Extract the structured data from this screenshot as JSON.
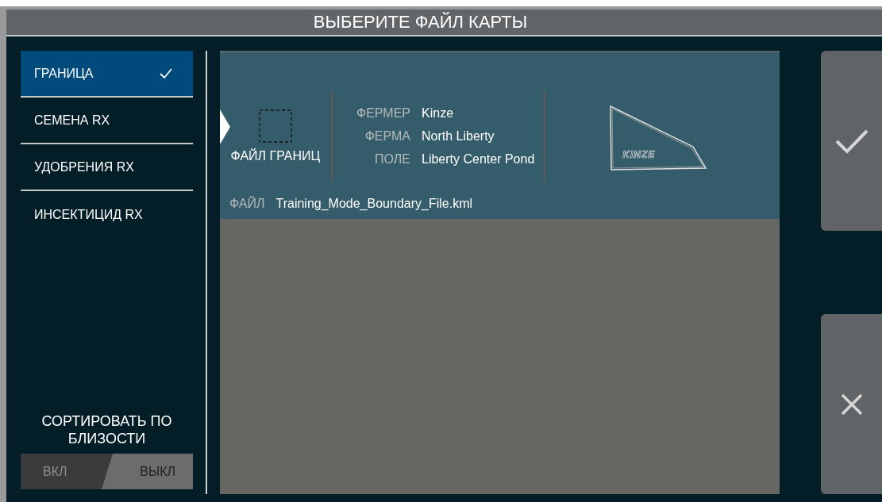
{
  "window": {
    "title": "ВЫБЕРИТЕ ФАЙЛ КАРТЫ"
  },
  "categories": [
    {
      "label": "ГРАНИЦА",
      "selected": true
    },
    {
      "label": "СЕМЕНА RX",
      "selected": false
    },
    {
      "label": "УДОБРЕНИЯ RX",
      "selected": false
    },
    {
      "label": "ИНСЕКТИЦИД RX",
      "selected": false
    }
  ],
  "sort": {
    "label": "СОРТИРОВАТЬ ПО БЛИЗОСТИ",
    "on": false,
    "on_label": "ВКЛ",
    "off_label": "ВЫКЛ"
  },
  "files": [
    {
      "selected": true,
      "type_label": "ФАЙЛ ГРАНИЦ",
      "fields": [
        {
          "label": "ФЕРМЕР",
          "value": "Kinze"
        },
        {
          "label": "ФЕРМА",
          "value": "North Liberty"
        },
        {
          "label": "ПОЛЕ",
          "value": "Liberty Center Pond"
        }
      ],
      "preview_logo": "KINZE",
      "file_label": "ФАЙЛ",
      "file_name": "Training_Mode_Boundary_File.kml"
    }
  ],
  "buttons": [
    {
      "kind": "confirm"
    },
    {
      "kind": "cancel"
    }
  ]
}
